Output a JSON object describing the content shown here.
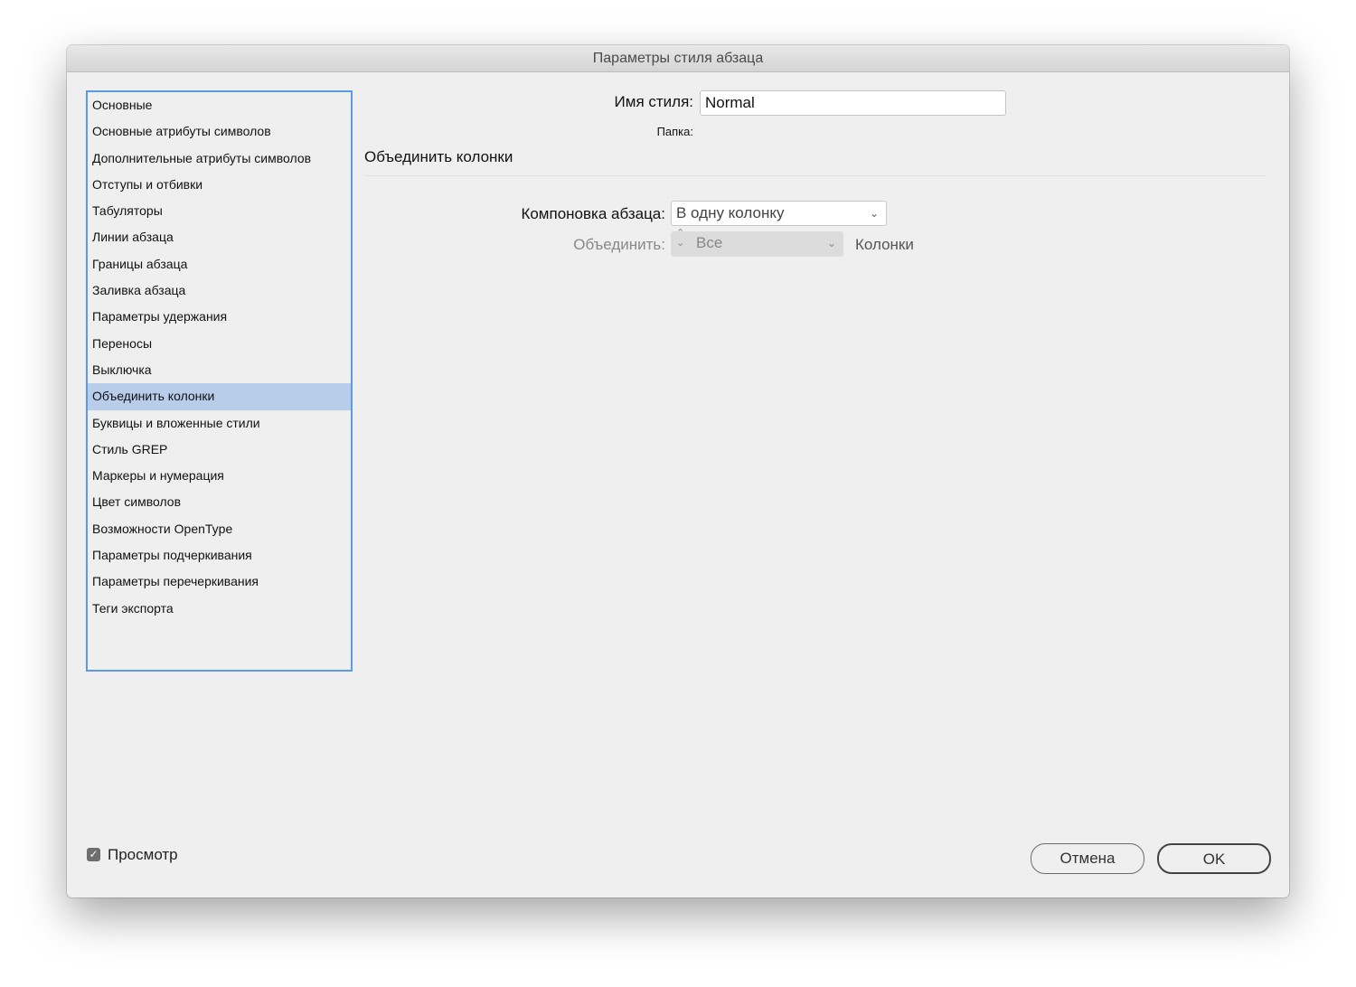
{
  "title": "Параметры стиля абзаца",
  "sidebar": {
    "items": [
      "Основные",
      "Основные атрибуты символов",
      "Дополнительные атрибуты символов",
      "Отступы и отбивки",
      "Табуляторы",
      "Линии абзаца",
      "Границы абзаца",
      "Заливка абзаца",
      "Параметры удержания",
      "Переносы",
      "Выключка",
      "Объединить колонки",
      "Буквицы и вложенные стили",
      "Стиль GREP",
      "Маркеры и нумерация",
      "Цвет символов",
      "Возможности OpenType",
      "Параметры подчеркивания",
      "Параметры перечеркивания",
      "Теги экспорта"
    ],
    "selected": 11
  },
  "style_name_label": "Имя стиля:",
  "style_name_value": "Normal",
  "folder_label": "Папка:",
  "section_title": "Объединить колонки",
  "layout_label": "Компоновка абзаца:",
  "layout_value": "В одну колонку",
  "span_label": "Объединить:",
  "span_value": "Все",
  "span_unit": "Колонки",
  "preview_label": "Просмотр",
  "preview_checked": true,
  "cancel_label": "Отмена",
  "ok_label": "OK"
}
